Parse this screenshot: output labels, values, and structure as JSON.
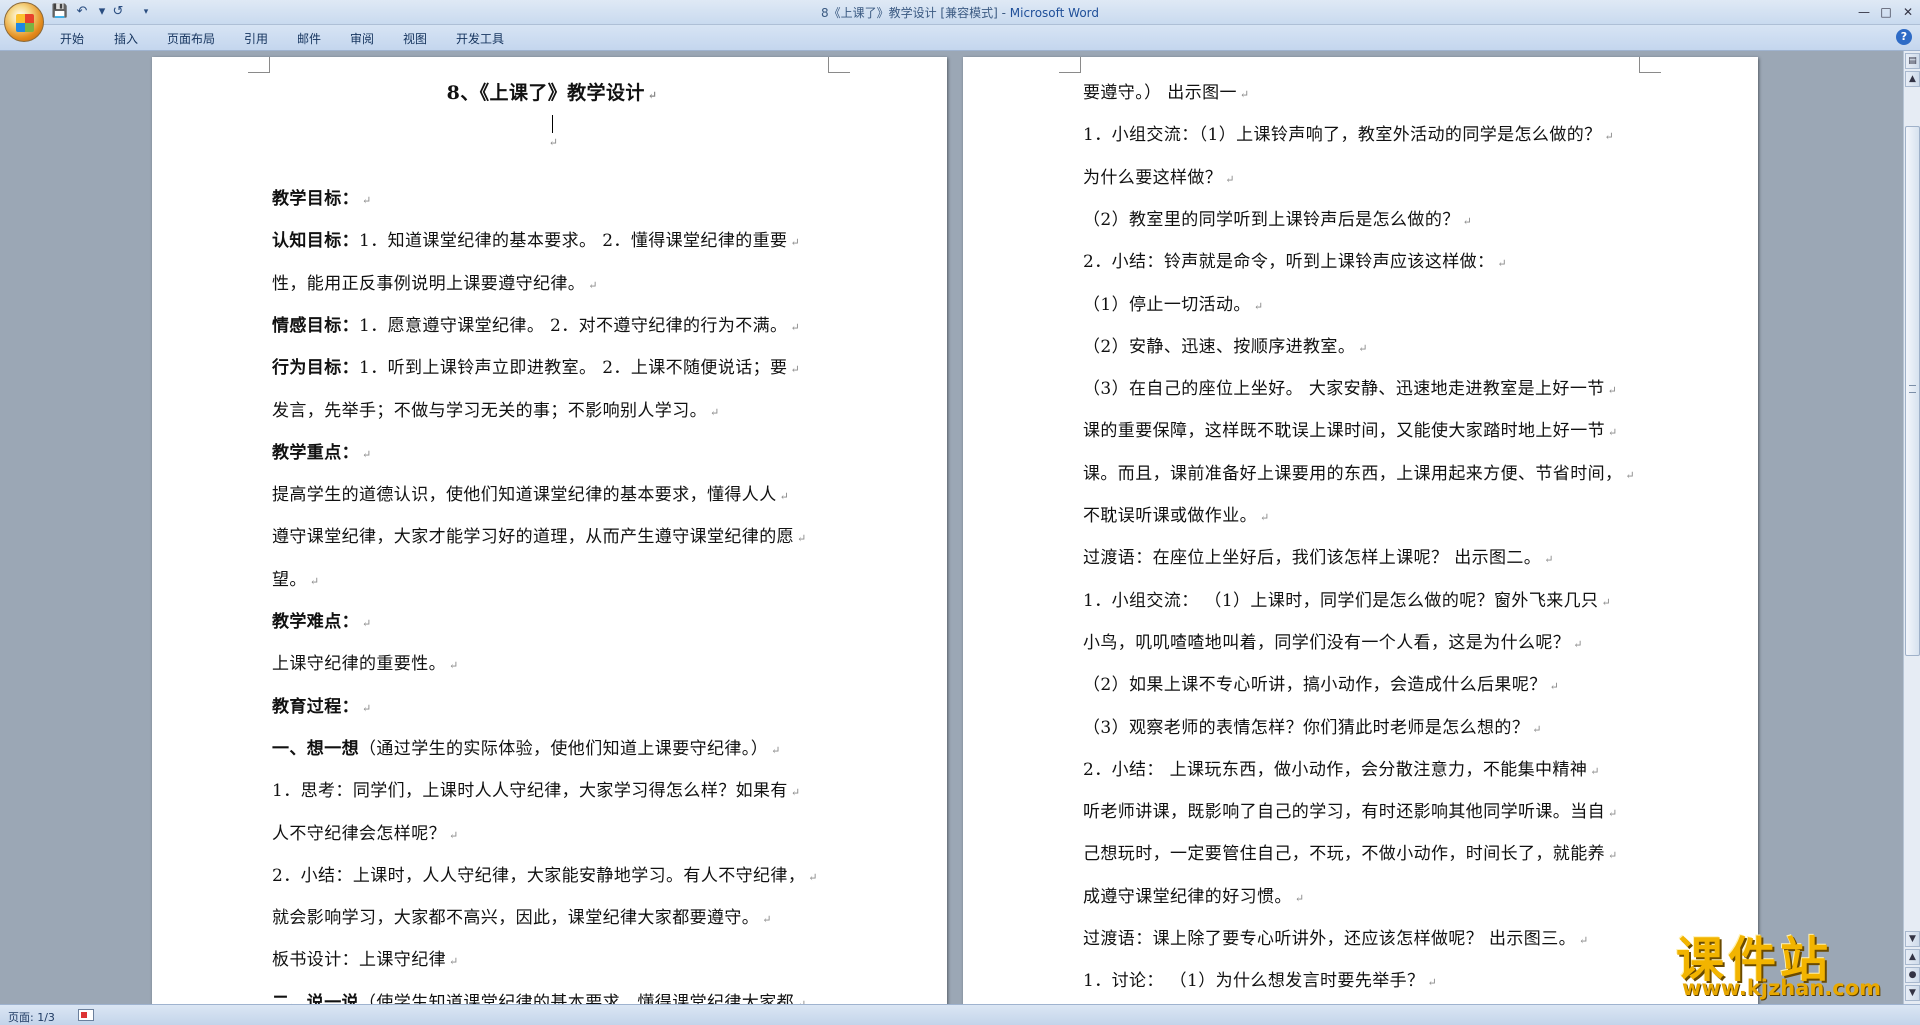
{
  "window": {
    "title": "8《上课了》教学设计 [兼容模式] - ",
    "app": "Microsoft Word"
  },
  "ribbon": {
    "tabs": [
      "开始",
      "插入",
      "页面布局",
      "引用",
      "邮件",
      "审阅",
      "视图",
      "开发工具"
    ]
  },
  "qat": {
    "icons": [
      "save-icon",
      "undo-icon",
      "redo-icon",
      "customize-icon"
    ]
  },
  "page1": {
    "title": "8、《上课了》教学设计",
    "lines": [
      {
        "bold": "教学目标：",
        "text": ""
      },
      {
        "bold": "认知目标：",
        "text": "1．知道课堂纪律的基本要求。 2．懂得课堂纪律的重要"
      },
      {
        "bold": "",
        "text": "性，能用正反事例说明上课要遵守纪律。"
      },
      {
        "bold": " 情感目标：",
        "text": "1．愿意遵守课堂纪律。 2．对不遵守纪律的行为不满。"
      },
      {
        "bold": "行为目标：",
        "text": "1．听到上课铃声立即进教室。 2．上课不随便说话；要"
      },
      {
        "bold": "",
        "text": "发言，先举手；不做与学习无关的事；不影响别人学习。"
      },
      {
        "bold": "教学重点：",
        "text": ""
      },
      {
        "bold": "",
        "text": " 提高学生的道德认识，使他们知道课堂纪律的基本要求，懂得人人"
      },
      {
        "bold": "",
        "text": "遵守课堂纪律，大家才能学习好的道理，从而产生遵守课堂纪律的愿"
      },
      {
        "bold": "",
        "text": "望。"
      },
      {
        "bold": " 教学难点：",
        "text": ""
      },
      {
        "bold": "",
        "text": "上课守纪律的重要性。"
      },
      {
        "bold": "教育过程：",
        "text": ""
      },
      {
        "bold": " 一、想一想",
        "text": "（通过学生的实际体验，使他们知道上课要守纪律。）"
      },
      {
        "bold": "",
        "text": " 1．思考：同学们，上课时人人守纪律，大家学习得怎么样？如果有"
      },
      {
        "bold": "",
        "text": "人不守纪律会怎样呢？"
      },
      {
        "bold": "",
        "text": " 2．小结：上课时，人人守纪律，大家能安静地学习。有人不守纪律，"
      },
      {
        "bold": "",
        "text": "就会影响学习，大家都不高兴，因此，课堂纪律大家都要遵守。"
      },
      {
        "bold": "",
        "text": " 板书设计：上课守纪律"
      },
      {
        "bold": "二、说一说",
        "text": "（使学生知道课堂纪律的基本要求，懂得课堂纪律大家都"
      }
    ]
  },
  "page2": {
    "lines": [
      "要遵守。） 出示图一",
      " 1．小组交流：（1）上课铃声响了，教室外活动的同学是怎么做的？",
      "为什么要这样做？",
      "（2）教室里的同学听到上课铃声后是怎么做的？",
      "2．小结：铃声就是命令，听到上课铃声应该这样做：",
      "（1）停止一切活动。",
      "（2）安静、迅速、按顺序进教室。",
      "（3）在自己的座位上坐好。 大家安静、迅速地走进教室是上好一节",
      "课的重要保障，这样既不耽误上课时间，又能使大家踏时地上好一节",
      "课。而且，课前准备好上课要用的东西，上课用起来方便、节省时间，",
      "不耽误听课或做作业。",
      " 过渡语：在座位上坐好后，我们该怎样上课呢？ 出示图二。",
      "1．小组交流： （1）上课时，同学们是怎么做的呢？窗外飞来几只",
      "小鸟，叽叽喳喳地叫着，同学们没有一个人看，这是为什么呢？",
      "（2）如果上课不专心听讲，搞小动作，会造成什么后果呢？",
      "（3）观察老师的表情怎样？你们猜此时老师是怎么想的？",
      " 2．小结： 上课玩东西，做小动作，会分散注意力，不能集中精神",
      "听老师讲课，既影响了自己的学习，有时还影响其他同学听课。当自",
      "己想玩时，一定要管住自己，不玩，不做小动作，时间长了，就能养",
      "成遵守课堂纪律的好习惯。",
      "过渡语：课上除了要专心听讲外，还应该怎样做呢？ 出示图三。",
      "1．讨论： （1）为什么想发言时要先举手？"
    ]
  },
  "status": {
    "page": "页面: 1/3"
  },
  "watermark": {
    "cn": "课件站",
    "url": "www.kjzhan.com"
  },
  "colors": {
    "workspace": "#9ba7b5",
    "ribbon": "#c4d6ee",
    "watermark": "#f2b400"
  }
}
